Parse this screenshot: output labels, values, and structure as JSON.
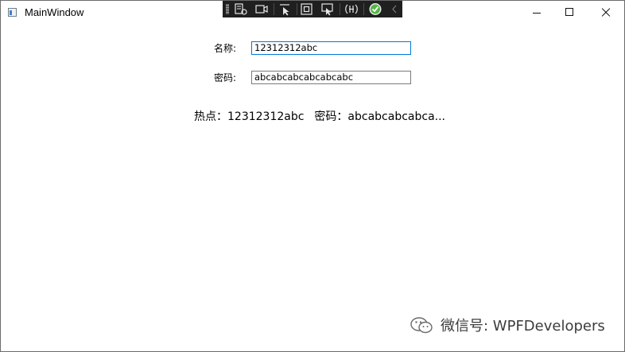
{
  "window": {
    "title": "MainWindow"
  },
  "form": {
    "name_label": "名称:",
    "name_value": "12312312abc",
    "password_label": "密码:",
    "password_value": "abcabcabcabcabcabc"
  },
  "hot": {
    "prefix": "热点：",
    "name_value": "12312312abc",
    "pwd_prefix": "密码：",
    "pwd_value": "abcabcabcabca..."
  },
  "watermark": {
    "text": "微信号: WPFDevelopers",
    "icon": "wechat-icon"
  },
  "devtools": {
    "icons": [
      "grip-icon",
      "live-tree-icon",
      "record-icon",
      "select-element-icon",
      "display-layout-adorners-icon",
      "track-focus-icon",
      "binding-failures-icon",
      "hot-reload-ok-icon",
      "collapse-icon"
    ]
  }
}
